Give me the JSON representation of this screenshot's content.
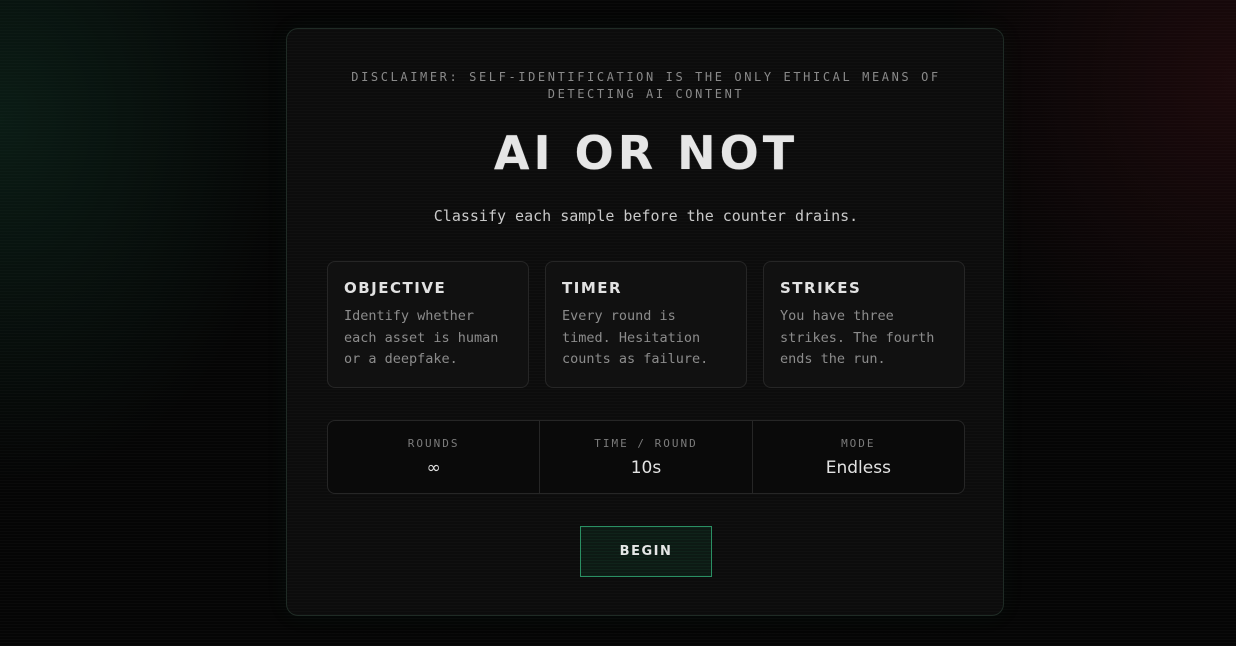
{
  "disclaimer": "DISCLAIMER: SELF-IDENTIFICATION IS THE ONLY ETHICAL MEANS OF DETECTING AI CONTENT",
  "title": "AI OR NOT",
  "subtitle": "Classify each sample before the counter drains.",
  "info_cards": [
    {
      "title": "OBJECTIVE",
      "body": "Identify whether each asset is human or a deepfake."
    },
    {
      "title": "TIMER",
      "body": "Every round is timed. Hesitation counts as failure."
    },
    {
      "title": "STRIKES",
      "body": "You have three strikes. The fourth ends the run."
    }
  ],
  "stats": [
    {
      "label": "ROUNDS",
      "value": "∞"
    },
    {
      "label": "TIME / ROUND",
      "value": "10s"
    },
    {
      "label": "MODE",
      "value": "Endless"
    }
  ],
  "begin_label": "BEGIN",
  "colors": {
    "accent": "#2a8f63",
    "background": "#050505",
    "card": "#0c0c0c"
  }
}
